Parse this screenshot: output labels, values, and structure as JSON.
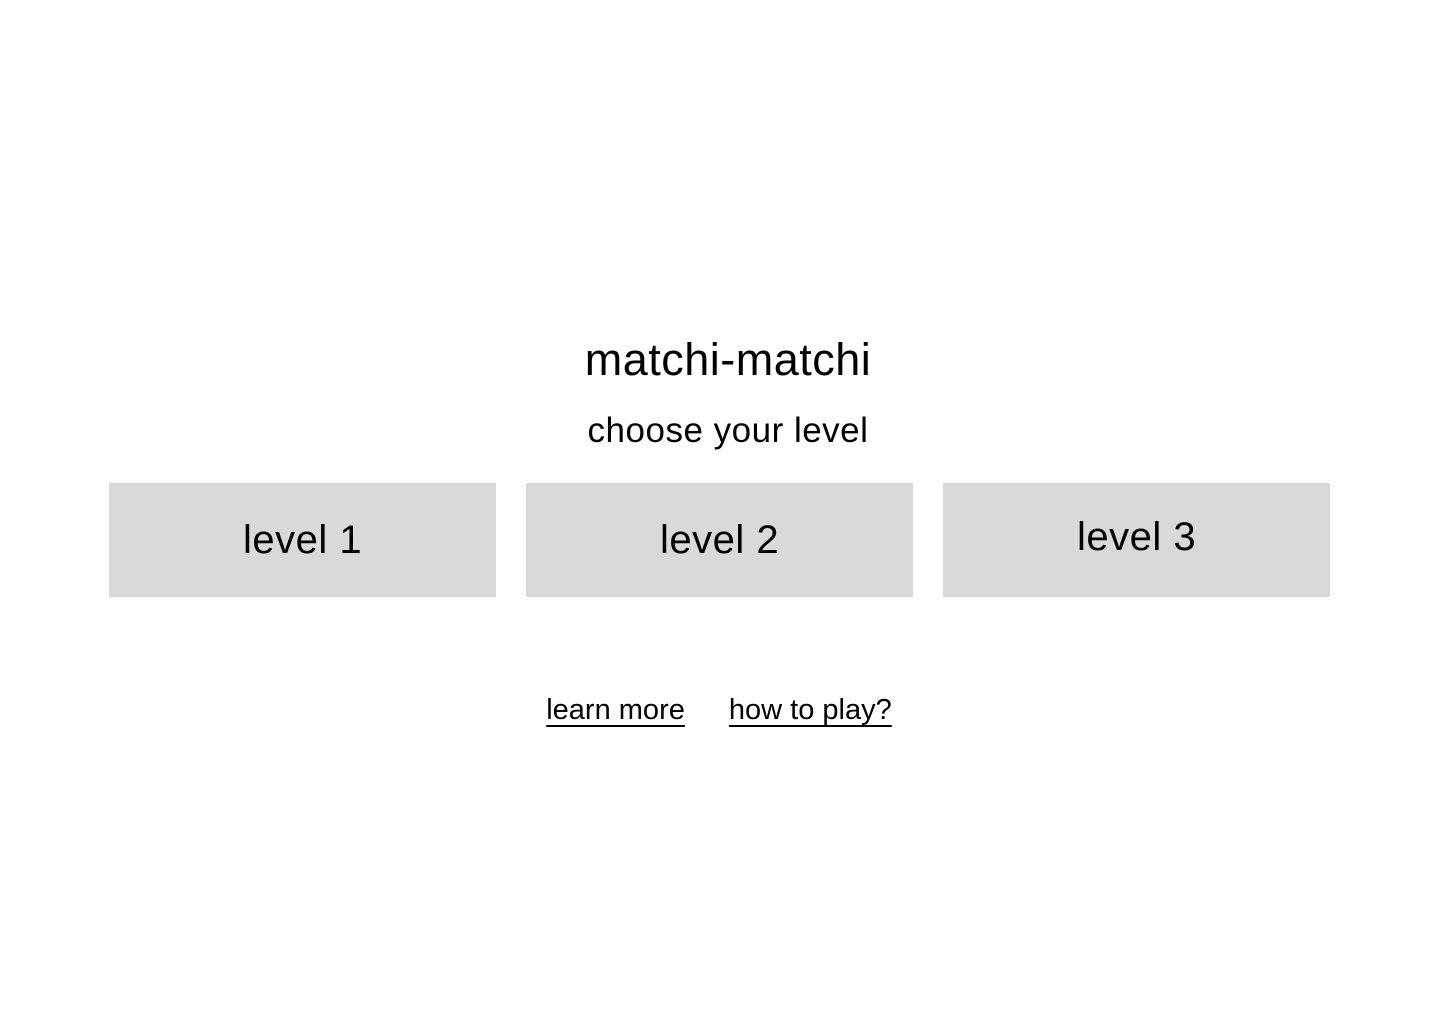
{
  "header": {
    "title": "matchi-matchi",
    "subtitle": "choose your level"
  },
  "levels": [
    {
      "label": "level 1"
    },
    {
      "label": "level 2"
    },
    {
      "label": "level 3"
    }
  ],
  "links": {
    "learn_more": "learn more",
    "how_to_play": "how to play?"
  },
  "colors": {
    "background": "#ffffff",
    "button_background": "#d9d9d9",
    "text": "#000000"
  }
}
